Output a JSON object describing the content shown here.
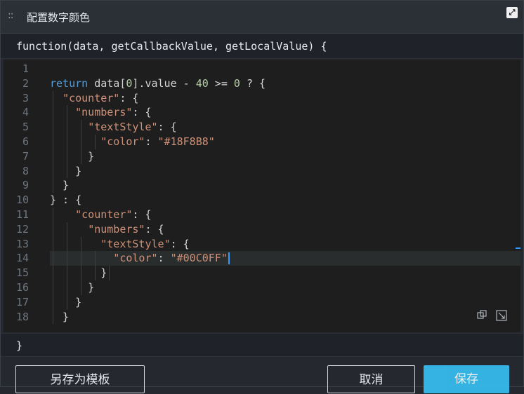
{
  "dialog": {
    "title": "配置数字颜色",
    "drag_glyph": "::",
    "fullscreen_glyph": "⤢"
  },
  "editor": {
    "header": "function(data, getCallbackValue, getLocalValue) {",
    "footer": "}",
    "line_numbers": [
      "1",
      "2",
      "3",
      "4",
      "5",
      "6",
      "7",
      "8",
      "9",
      "10",
      "11",
      "12",
      "13",
      "14",
      "15",
      "16",
      "17",
      "18"
    ],
    "lines": [
      "",
      "return data[0].value - 40 >= 0 ? {",
      "  \"counter\": {",
      "    \"numbers\": {",
      "      \"textStyle\": {",
      "        \"color\": \"#18F8B8\"",
      "      }",
      "    }",
      "  }",
      "} : {",
      "    \"counter\": {",
      "      \"numbers\": {",
      "        \"textStyle\": {",
      "          \"color\": \"#00C0FF\"",
      "        }",
      "      }",
      "    }",
      "  }"
    ],
    "current_line": 14,
    "tools": {
      "copy_icon": "copy-icon",
      "expand_icon": "expand-icon"
    }
  },
  "buttons": {
    "save_as_template": "另存为模板",
    "cancel": "取消",
    "save": "保存"
  },
  "colors": {
    "keyword": "#569cd6",
    "string": "#ce9178",
    "number": "#b5cea8",
    "accent": "#36bff2"
  }
}
